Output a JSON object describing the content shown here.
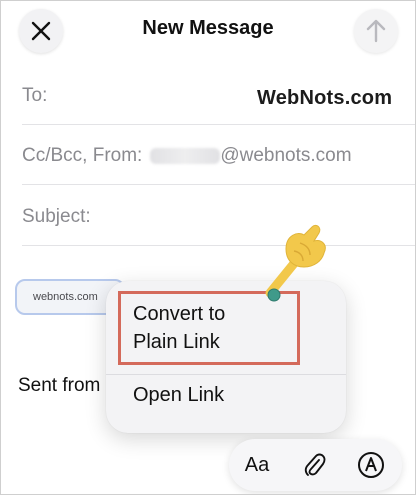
{
  "header": {
    "title": "New Message",
    "close_icon": "close-icon",
    "send_icon": "arrow-up-icon"
  },
  "fields": {
    "to_label": "To:",
    "cc_label": "Cc/Bcc, From:",
    "from_domain": "@webnots.com",
    "subject_label": "Subject:"
  },
  "watermark": "WebNots.com",
  "body": {
    "link_text": "webnots.com",
    "signature": "Sent from"
  },
  "context_menu": {
    "convert_line1": "Convert to",
    "convert_line2": "Plain Link",
    "open_link": "Open Link"
  },
  "toolbar": {
    "format_label": "Aa",
    "attach_icon": "paperclip-icon",
    "markup_icon": "markup-pen-icon"
  },
  "colors": {
    "highlight_border": "#d46a5b",
    "pointer_fill": "#f2c84b",
    "pointer_dot": "#3f9a8a",
    "link_chip_border": "#b7c9ec"
  }
}
